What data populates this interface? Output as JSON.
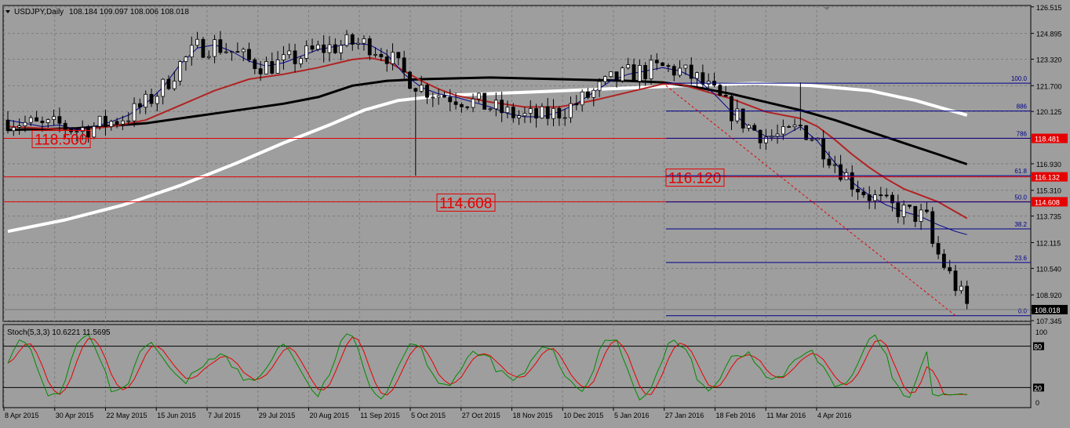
{
  "header": {
    "symbol": "USDJPY,Daily",
    "ohlc": "108.184 109.097 108.006 108.018"
  },
  "indicator": {
    "label": "Stoch(5,3,3) 10.6221 11.5695",
    "scale_labels": [
      "100",
      "80",
      "20",
      "0"
    ]
  },
  "colors": {
    "background": "#9e9e9e",
    "grid": "#7c7c7c",
    "candles": "#000000",
    "ma_fast": "#00008b",
    "ma_mid": "#b22222",
    "ma_slow": "#000000",
    "ma_long": "#ffffff",
    "fib": "#00008b",
    "level": "#e60000",
    "stoch_main": "#008a00",
    "stoch_signal": "#e60000"
  },
  "chart_data": {
    "type": "line",
    "title": "",
    "y_ticks": [
      "126.515",
      "124.895",
      "123.320",
      "121.700",
      "120.125",
      "118.481",
      "116.930",
      "116.132",
      "115.310",
      "114.608",
      "113.735",
      "112.115",
      "110.540",
      "108.920",
      "108.018",
      "107.345"
    ],
    "x_ticks": [
      "8 Apr 2015",
      "30 Apr 2015",
      "22 May 2015",
      "15 Jun 2015",
      "7 Jul 2015",
      "29 Jul 2015",
      "20 Aug 2015",
      "11 Sep 2015",
      "5 Oct 2015",
      "27 Oct 2015",
      "18 Nov 2015",
      "10 Dec 2015",
      "5 Jan 2016",
      "27 Jan 2016",
      "18 Feb 2016",
      "11 Mar 2016",
      "4 Apr 2016"
    ],
    "ylim": [
      107.3,
      126.6
    ],
    "horizontal_levels": [
      {
        "value": 118.481,
        "tag": "118.481",
        "label": "118.500"
      },
      {
        "value": 116.132,
        "tag": "116.132",
        "label": "116.120"
      },
      {
        "value": 114.608,
        "tag": "114.608",
        "label": "114.608"
      }
    ],
    "fibonacci": [
      {
        "level": "100.0",
        "price": 121.85
      },
      {
        "level": "886",
        "price": 120.15
      },
      {
        "level": "786",
        "price": 118.49
      },
      {
        "level": "61.8",
        "price": 116.2
      },
      {
        "level": "50.0",
        "price": 114.6
      },
      {
        "level": "38.2",
        "price": 112.95
      },
      {
        "level": "23.6",
        "price": 110.9
      },
      {
        "level": "0.0",
        "price": 107.65
      }
    ],
    "current_price": "108.018",
    "trendline": {
      "from": {
        "date": "27 Jan 2016",
        "price": 121.7
      },
      "to": {
        "price": 107.65
      }
    },
    "series": [
      {
        "values": [
          [
            0,
            119.6
          ],
          [
            3,
            119.4
          ],
          [
            6,
            119.2
          ],
          [
            9,
            119.3
          ],
          [
            12,
            119.0
          ],
          [
            15,
            119.2
          ],
          [
            18,
            119.5
          ],
          [
            21,
            119.9
          ],
          [
            24,
            120.6
          ],
          [
            27,
            121.6
          ],
          [
            30,
            123.0
          ],
          [
            33,
            124.0
          ],
          [
            36,
            124.2
          ],
          [
            39,
            123.8
          ],
          [
            42,
            123.2
          ],
          [
            45,
            122.9
          ],
          [
            48,
            123.1
          ],
          [
            51,
            123.5
          ],
          [
            54,
            123.9
          ],
          [
            57,
            124.1
          ],
          [
            60,
            124.3
          ],
          [
            63,
            124.2
          ],
          [
            66,
            123.6
          ],
          [
            69,
            122.4
          ],
          [
            72,
            121.6
          ],
          [
            75,
            121.2
          ],
          [
            78,
            121.0
          ],
          [
            81,
            120.7
          ],
          [
            84,
            120.4
          ],
          [
            87,
            120.0
          ],
          [
            90,
            119.8
          ],
          [
            93,
            119.8
          ],
          [
            96,
            120.1
          ],
          [
            99,
            120.6
          ],
          [
            102,
            121.3
          ],
          [
            105,
            122.0
          ],
          [
            108,
            122.4
          ],
          [
            111,
            122.6
          ],
          [
            114,
            122.8
          ],
          [
            117,
            122.6
          ],
          [
            120,
            122.1
          ],
          [
            123,
            121.2
          ],
          [
            126,
            120.1
          ],
          [
            129,
            119.2
          ],
          [
            132,
            118.6
          ],
          [
            135,
            118.6
          ],
          [
            138,
            119.2
          ],
          [
            141,
            118.3
          ],
          [
            144,
            117.0
          ],
          [
            147,
            115.8
          ],
          [
            150,
            115.0
          ],
          [
            153,
            114.4
          ],
          [
            156,
            114.0
          ],
          [
            159,
            113.7
          ],
          [
            162,
            113.2
          ],
          [
            165,
            112.8
          ],
          [
            167,
            112.6
          ]
        ]
      },
      {
        "values": [
          [
            0,
            119.2
          ],
          [
            6,
            119.1
          ],
          [
            12,
            119.0
          ],
          [
            18,
            119.2
          ],
          [
            24,
            119.6
          ],
          [
            30,
            120.5
          ],
          [
            36,
            121.4
          ],
          [
            42,
            122.1
          ],
          [
            48,
            122.4
          ],
          [
            54,
            122.8
          ],
          [
            60,
            123.3
          ],
          [
            63,
            123.4
          ],
          [
            66,
            123.2
          ],
          [
            69,
            122.6
          ],
          [
            72,
            122.0
          ],
          [
            75,
            121.5
          ],
          [
            78,
            121.1
          ],
          [
            84,
            120.7
          ],
          [
            90,
            120.4
          ],
          [
            96,
            120.4
          ],
          [
            102,
            120.8
          ],
          [
            108,
            121.3
          ],
          [
            114,
            121.8
          ],
          [
            117,
            121.8
          ],
          [
            120,
            121.5
          ],
          [
            126,
            120.9
          ],
          [
            132,
            120.1
          ],
          [
            138,
            119.7
          ],
          [
            141,
            119.2
          ],
          [
            144,
            118.4
          ],
          [
            147,
            117.5
          ],
          [
            150,
            116.7
          ],
          [
            153,
            116.0
          ],
          [
            156,
            115.4
          ],
          [
            159,
            115.0
          ],
          [
            162,
            114.6
          ],
          [
            165,
            114.0
          ],
          [
            167,
            113.6
          ]
        ]
      },
      {
        "values": [
          [
            0,
            119.0
          ],
          [
            12,
            119.1
          ],
          [
            24,
            119.4
          ],
          [
            36,
            120.0
          ],
          [
            48,
            120.6
          ],
          [
            54,
            121.0
          ],
          [
            60,
            121.7
          ],
          [
            66,
            122.0
          ],
          [
            72,
            122.1
          ],
          [
            84,
            122.2
          ],
          [
            96,
            122.1
          ],
          [
            108,
            122.0
          ],
          [
            114,
            121.9
          ],
          [
            120,
            121.6
          ],
          [
            126,
            121.2
          ],
          [
            132,
            120.7
          ],
          [
            138,
            120.2
          ],
          [
            144,
            119.6
          ],
          [
            150,
            118.9
          ],
          [
            156,
            118.2
          ],
          [
            162,
            117.5
          ],
          [
            167,
            116.9
          ]
        ]
      },
      {
        "values": [
          [
            0,
            112.8
          ],
          [
            10,
            113.5
          ],
          [
            20,
            114.4
          ],
          [
            30,
            115.6
          ],
          [
            40,
            117.0
          ],
          [
            48,
            118.2
          ],
          [
            56,
            119.3
          ],
          [
            62,
            120.2
          ],
          [
            68,
            120.8
          ],
          [
            76,
            121.1
          ],
          [
            90,
            121.3
          ],
          [
            104,
            121.5
          ],
          [
            118,
            121.7
          ],
          [
            130,
            121.85
          ],
          [
            140,
            121.7
          ],
          [
            150,
            121.4
          ],
          [
            158,
            120.8
          ],
          [
            167,
            119.9
          ]
        ]
      }
    ]
  }
}
